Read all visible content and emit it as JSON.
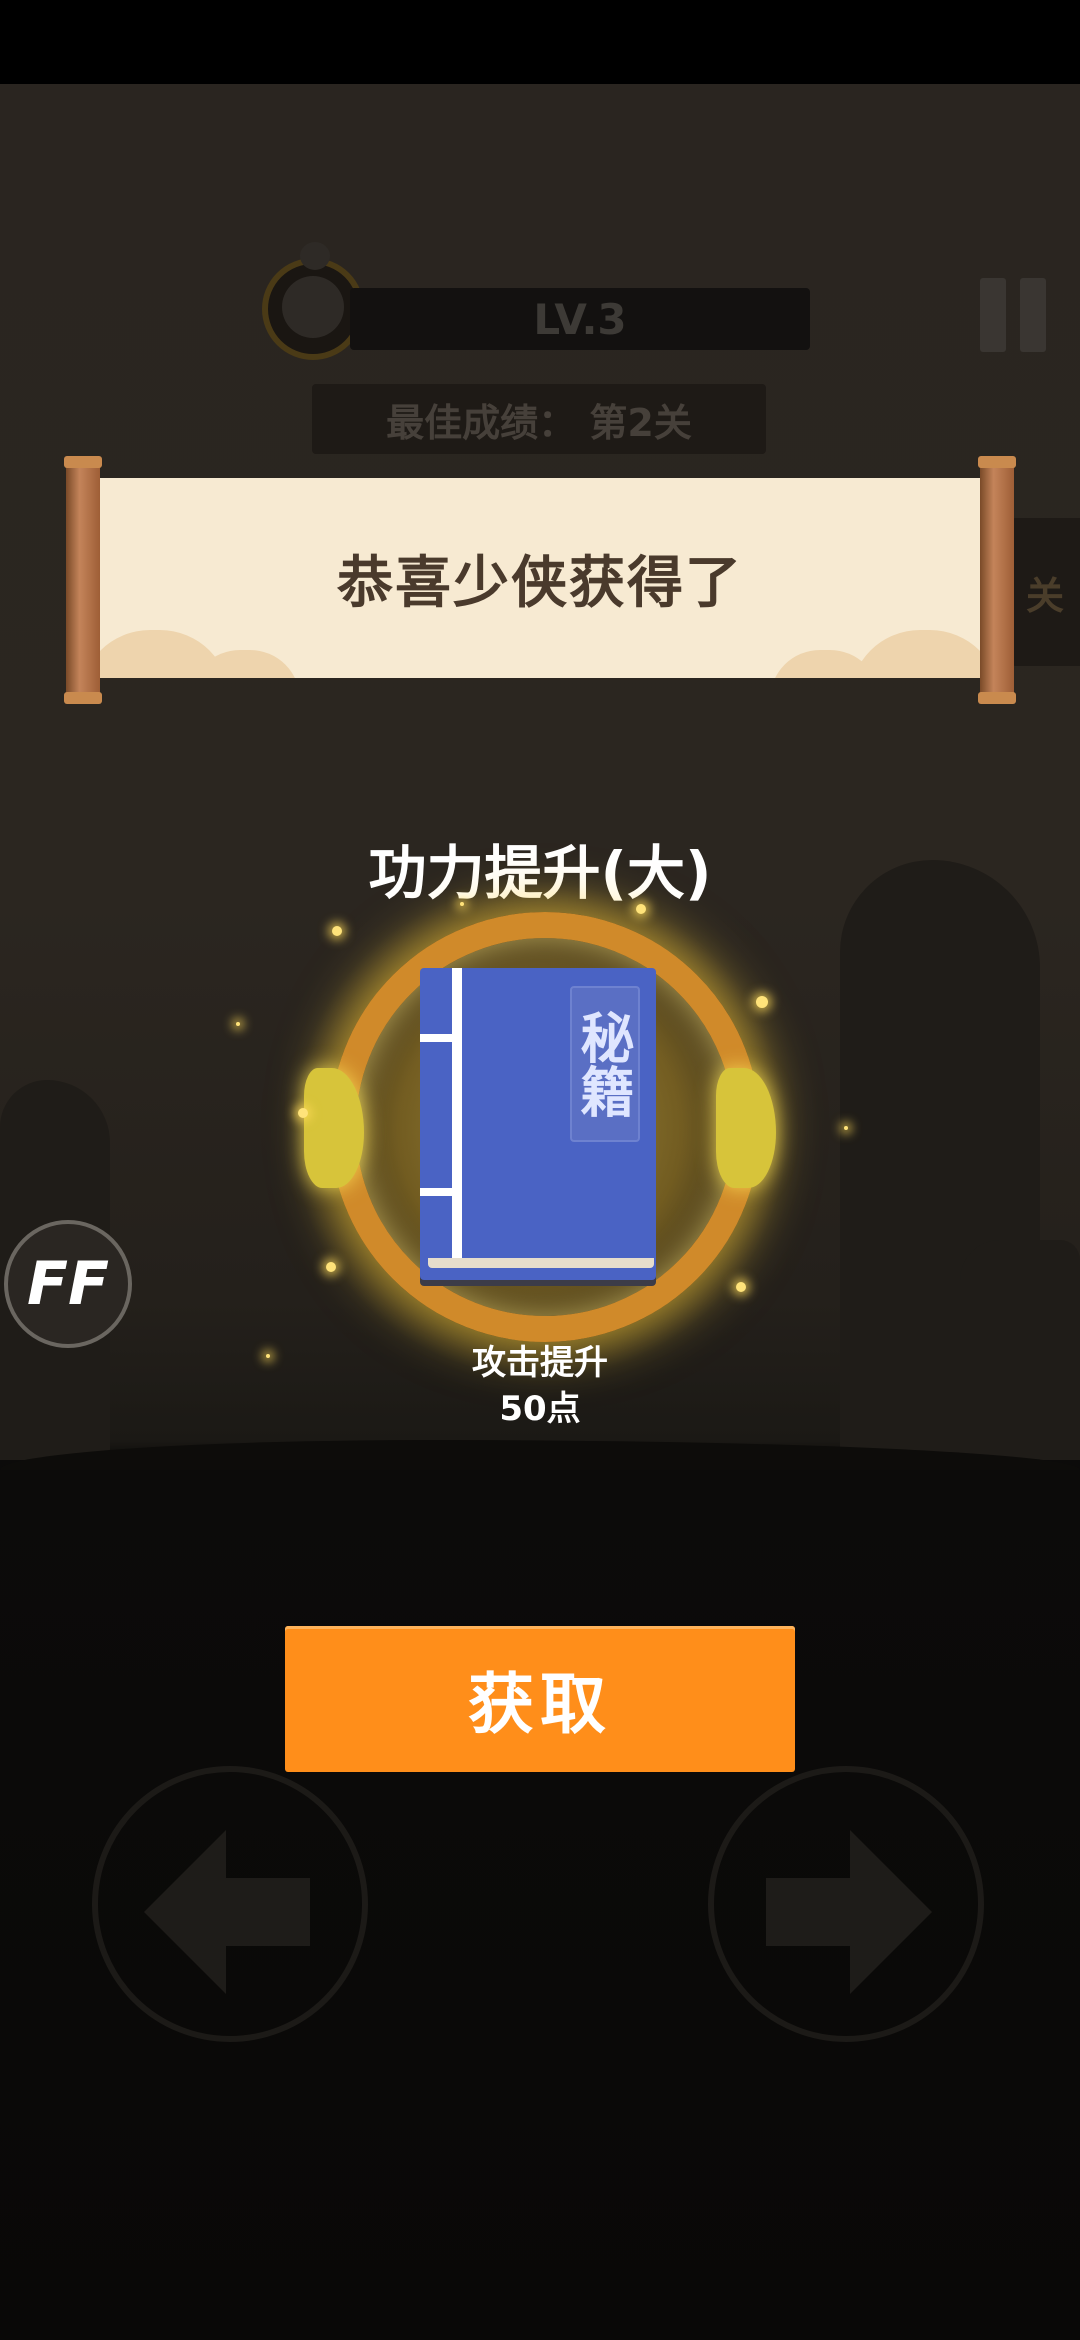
{
  "hud": {
    "level": "LV.3",
    "best_score": "最佳成绩： 第2关",
    "side_tab": "关"
  },
  "banner": {
    "title": "恭喜少侠获得了"
  },
  "reward": {
    "name": "功力提升(大)",
    "book_label": "秘籍",
    "description_line1": "攻击提升",
    "description_line2": "50点"
  },
  "badge": {
    "text": "FF"
  },
  "actions": {
    "get_label": "获取"
  },
  "icons": {
    "left": "left-arrow-icon",
    "right": "right-arrow-icon",
    "pause": "pause-icon"
  },
  "colors": {
    "accent": "#ff8e1a",
    "book": "#4a63c4",
    "banner_paper": "#f7ead2"
  }
}
